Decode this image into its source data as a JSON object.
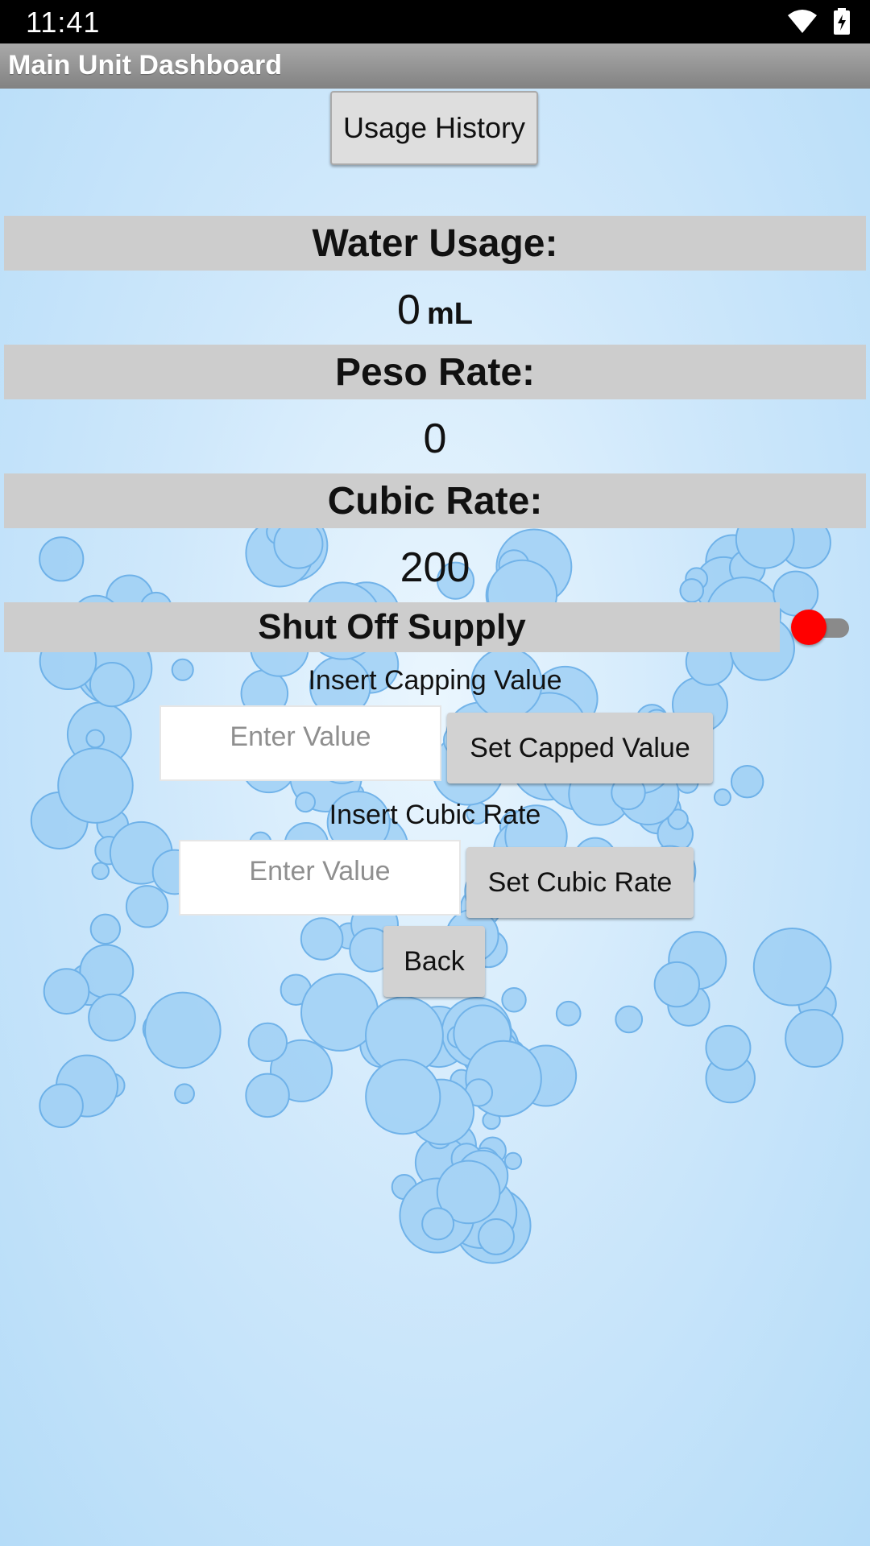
{
  "status_bar": {
    "time": "11:41",
    "icons": [
      "wifi-icon",
      "battery-charging-icon"
    ]
  },
  "app_bar": {
    "title": "Main Unit Dashboard"
  },
  "buttons": {
    "usage_history": "Usage History",
    "set_capped_value": "Set Capped Value",
    "set_cubic_rate": "Set Cubic Rate",
    "back": "Back"
  },
  "water_usage": {
    "label": "Water Usage:",
    "value": "0",
    "unit": "mL"
  },
  "peso_rate": {
    "label": "Peso Rate:",
    "value": "0"
  },
  "cubic_rate": {
    "label": "Cubic Rate:",
    "value": "200"
  },
  "shut_off": {
    "label": "Shut Off Supply",
    "toggle_on": false,
    "thumb_color": "#ff0000"
  },
  "capping": {
    "label": "Insert Capping Value",
    "placeholder": "Enter Value",
    "value": ""
  },
  "cubic_input": {
    "label": "Insert Cubic Rate",
    "placeholder": "Enter Value",
    "value": ""
  },
  "colors": {
    "section_bar": "#cdcdcd",
    "app_bar": "#939393",
    "background": "#cfe8fb"
  }
}
